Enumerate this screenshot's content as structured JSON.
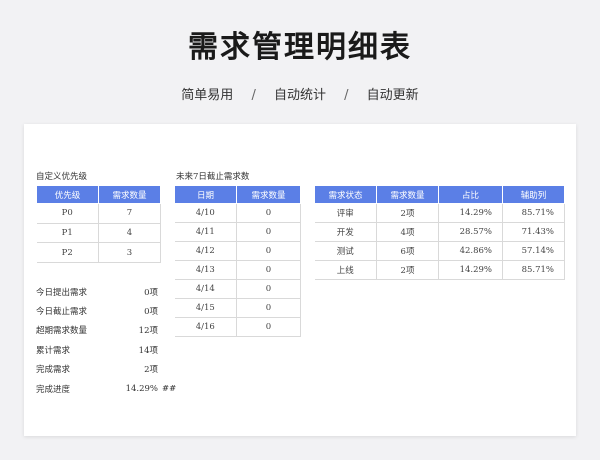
{
  "header": {
    "title": "需求管理明细表",
    "features": [
      "简单易用",
      "自动统计",
      "自动更新"
    ],
    "separator": "/"
  },
  "priority": {
    "caption": "自定义优先级",
    "columns": [
      "优先级",
      "需求数量"
    ],
    "rows": [
      [
        "P0",
        "7"
      ],
      [
        "P1",
        "4"
      ],
      [
        "P2",
        "3"
      ]
    ]
  },
  "deadline": {
    "caption": "未来7日截止需求数",
    "columns": [
      "日期",
      "需求数量"
    ],
    "rows": [
      [
        "4/10",
        "0"
      ],
      [
        "4/11",
        "0"
      ],
      [
        "4/12",
        "0"
      ],
      [
        "4/13",
        "0"
      ],
      [
        "4/14",
        "0"
      ],
      [
        "4/15",
        "0"
      ],
      [
        "4/16",
        "0"
      ]
    ]
  },
  "status": {
    "columns": [
      "需求状态",
      "需求数量",
      "占比",
      "辅助列"
    ],
    "rows": [
      [
        "评审",
        "2项",
        "14.29%",
        "85.71%"
      ],
      [
        "开发",
        "4项",
        "28.57%",
        "71.43%"
      ],
      [
        "测试",
        "6项",
        "42.86%",
        "57.14%"
      ],
      [
        "上线",
        "2项",
        "14.29%",
        "85.71%"
      ]
    ]
  },
  "stats": [
    {
      "label": "今日提出需求",
      "value": "0项"
    },
    {
      "label": "今日截止需求",
      "value": "0项"
    },
    {
      "label": "超期需求数量",
      "value": "12项"
    },
    {
      "label": "累计需求",
      "value": "14项"
    },
    {
      "label": "完成需求",
      "value": "2项"
    },
    {
      "label": "完成进度",
      "value": "14.29%",
      "extra": "##"
    }
  ],
  "colors": {
    "header_fill": "#5b7fe6",
    "background": "#f2f2f4",
    "sheet": "#ffffff"
  }
}
